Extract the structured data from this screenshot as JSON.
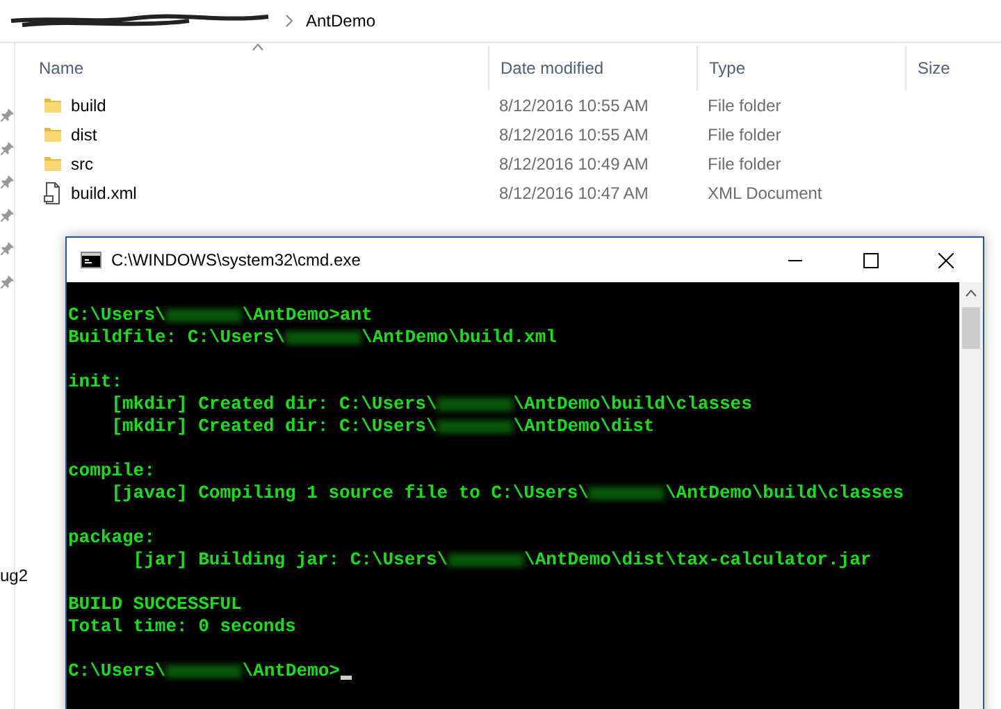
{
  "breadcrumb": {
    "current": "AntDemo"
  },
  "columns": [
    "Name",
    "Date modified",
    "Type",
    "Size"
  ],
  "files": [
    {
      "kind": "folder",
      "name": "build",
      "date": "8/12/2016 10:55 AM",
      "type": "File folder"
    },
    {
      "kind": "folder",
      "name": "dist",
      "date": "8/12/2016 10:55 AM",
      "type": "File folder"
    },
    {
      "kind": "folder",
      "name": "src",
      "date": "8/12/2016 10:49 AM",
      "type": "File folder"
    },
    {
      "kind": "xml",
      "name": "build.xml",
      "date": "8/12/2016 10:47 AM",
      "type": "XML Document"
    }
  ],
  "nav_pane": {
    "cut_label": "ug2"
  },
  "console": {
    "title": "C:\\WINDOWS\\system32\\cmd.exe",
    "lines": [
      {
        "kind": "text",
        "parts": [
          "C:\\Users\\",
          "\\AntDemo>ant"
        ]
      },
      {
        "kind": "text",
        "parts": [
          "Buildfile: C:\\Users\\",
          "\\AntDemo\\build.xml"
        ]
      },
      {
        "kind": "blank"
      },
      {
        "kind": "text",
        "parts": [
          "init:"
        ]
      },
      {
        "kind": "text",
        "parts": [
          "    [mkdir] Created dir: C:\\Users\\",
          "\\AntDemo\\build\\classes"
        ]
      },
      {
        "kind": "text",
        "parts": [
          "    [mkdir] Created dir: C:\\Users\\",
          "\\AntDemo\\dist"
        ]
      },
      {
        "kind": "blank"
      },
      {
        "kind": "text",
        "parts": [
          "compile:"
        ]
      },
      {
        "kind": "text",
        "parts": [
          "    [javac] Compiling 1 source file to C:\\Users\\",
          "\\AntDemo\\build\\classes"
        ]
      },
      {
        "kind": "blank"
      },
      {
        "kind": "text",
        "parts": [
          "package:"
        ]
      },
      {
        "kind": "text",
        "parts": [
          "      [jar] Building jar: C:\\Users\\",
          "\\AntDemo\\dist\\tax-calculator.jar"
        ]
      },
      {
        "kind": "blank"
      },
      {
        "kind": "text",
        "parts": [
          "BUILD SUCCESSFUL"
        ]
      },
      {
        "kind": "text",
        "parts": [
          "Total time: 0 seconds"
        ]
      },
      {
        "kind": "blank"
      },
      {
        "kind": "text",
        "parts": [
          "C:\\Users\\",
          "\\AntDemo>"
        ],
        "cursor": true
      }
    ]
  }
}
